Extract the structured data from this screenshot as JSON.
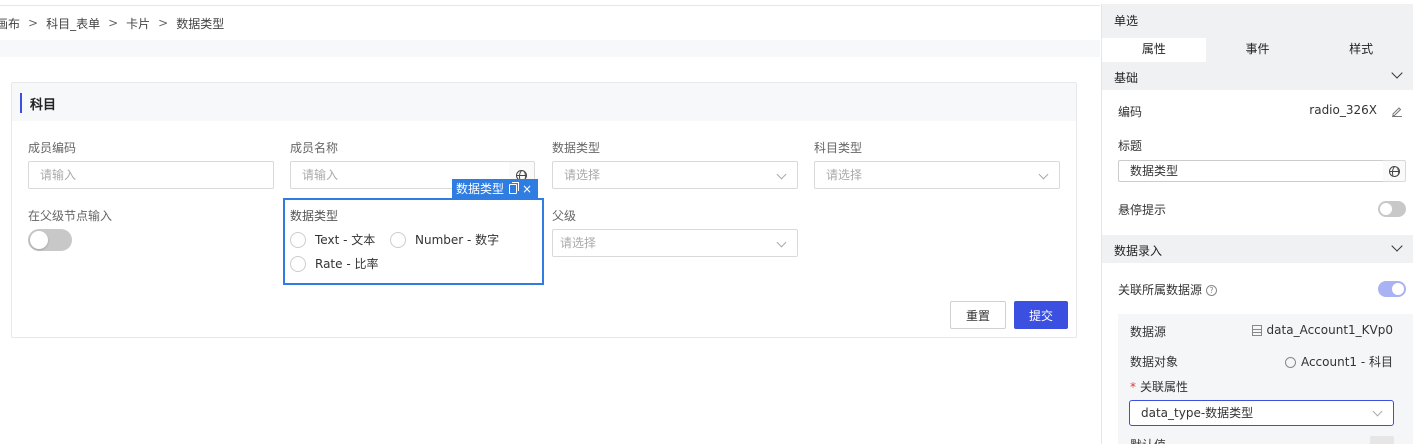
{
  "breadcrumb": {
    "items": [
      "画布",
      "科目_表单",
      "卡片",
      "数据类型"
    ],
    "separator": ">"
  },
  "card": {
    "title": "科目",
    "fields": {
      "member_code": {
        "label": "成员编码",
        "placeholder": "请输入"
      },
      "member_name": {
        "label": "成员名称",
        "placeholder": "请输入"
      },
      "data_type_select": {
        "label": "数据类型",
        "placeholder": "请选择"
      },
      "subject_type": {
        "label": "科目类型",
        "placeholder": "请选择"
      },
      "parent_input": {
        "label": "在父级节点输入",
        "value": false
      },
      "data_type_radio": {
        "label": "数据类型",
        "options": [
          "Text - 文本",
          "Number - 数字",
          "Rate - 比率"
        ]
      },
      "parent": {
        "label": "父级",
        "placeholder": "请选择"
      }
    },
    "selected_tag": {
      "label": "数据类型",
      "close": "×"
    },
    "buttons": {
      "reset": "重置",
      "submit": "提交"
    }
  },
  "panel": {
    "title": "单选",
    "tabs": [
      "属性",
      "事件",
      "样式"
    ],
    "active_tab": "属性",
    "sections": {
      "basic": "基础",
      "data_entry": "数据录入"
    },
    "code": {
      "label": "编码",
      "value": "radio_326X"
    },
    "title_field": {
      "label": "标题",
      "value": "数据类型"
    },
    "hover_tip": {
      "label": "悬停提示",
      "enabled": false
    },
    "linked_source": {
      "label": "关联所属数据源",
      "enabled": true
    },
    "data_source": {
      "label": "数据源",
      "value": "data_Account1_KVp0"
    },
    "data_object": {
      "label": "数据对象",
      "value": "Account1 - 科目"
    },
    "linked_attr": {
      "label": "关联属性",
      "required_mark": "*",
      "value": "data_type-数据类型"
    },
    "default_value": {
      "label": "默认值"
    }
  },
  "colors": {
    "primary": "#3b50e0",
    "selection": "#2f7de1",
    "toggle_on": "#a9b2f2"
  }
}
